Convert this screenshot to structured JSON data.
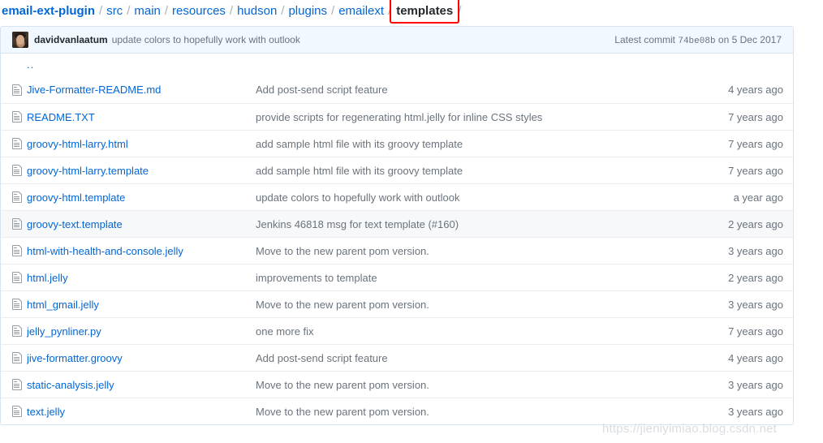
{
  "breadcrumb": {
    "repo": "email-ext-plugin",
    "separator": "/",
    "segments": [
      "src",
      "main",
      "resources",
      "hudson",
      "plugins",
      "emailext"
    ],
    "current": "templates",
    "trailing_separator": "/",
    "highlight_color": "#ff0000"
  },
  "commit_bar": {
    "author": "davidvanlaatum",
    "message": "update colors to hopefully work with outlook",
    "latest_commit_label": "Latest commit",
    "sha": "74be08b",
    "date_prefix": "on",
    "date": "5 Dec 2017",
    "background": "#f1f8ff"
  },
  "parent_row": {
    "label": "..",
    "icon": "up-directory-link"
  },
  "files": [
    {
      "icon": "file-icon",
      "name": "Jive-Formatter-README.md",
      "message": "Add post-send script feature",
      "age": "4 years ago",
      "hovered": false
    },
    {
      "icon": "file-icon",
      "name": "README.TXT",
      "message": "provide scripts for regenerating html.jelly for inline CSS styles",
      "age": "7 years ago",
      "hovered": false
    },
    {
      "icon": "file-icon",
      "name": "groovy-html-larry.html",
      "message": "add sample html file with its groovy template",
      "age": "7 years ago",
      "hovered": false
    },
    {
      "icon": "file-icon",
      "name": "groovy-html-larry.template",
      "message": "add sample html file with its groovy template",
      "age": "7 years ago",
      "hovered": false
    },
    {
      "icon": "file-icon",
      "name": "groovy-html.template",
      "message": "update colors to hopefully work with outlook",
      "age": "a year ago",
      "hovered": false
    },
    {
      "icon": "file-icon",
      "name": "groovy-text.template",
      "message": "Jenkins 46818 msg for text template (#160)",
      "age": "2 years ago",
      "hovered": true
    },
    {
      "icon": "file-icon",
      "name": "html-with-health-and-console.jelly",
      "message": "Move to the new parent pom version.",
      "age": "3 years ago",
      "hovered": false
    },
    {
      "icon": "file-icon",
      "name": "html.jelly",
      "message": "improvements to template",
      "age": "2 years ago",
      "hovered": false
    },
    {
      "icon": "file-icon",
      "name": "html_gmail.jelly",
      "message": "Move to the new parent pom version.",
      "age": "3 years ago",
      "hovered": false
    },
    {
      "icon": "file-icon",
      "name": "jelly_pynliner.py",
      "message": "one more fix",
      "age": "7 years ago",
      "hovered": false
    },
    {
      "icon": "file-icon",
      "name": "jive-formatter.groovy",
      "message": "Add post-send script feature",
      "age": "4 years ago",
      "hovered": false
    },
    {
      "icon": "file-icon",
      "name": "static-analysis.jelly",
      "message": "Move to the new parent pom version.",
      "age": "3 years ago",
      "hovered": false
    },
    {
      "icon": "file-icon",
      "name": "text.jelly",
      "message": "Move to the new parent pom version.",
      "age": "3 years ago",
      "hovered": false
    }
  ],
  "watermark": "https://jieniyimiao.blog.csdn.net",
  "colors": {
    "link": "#0366d6",
    "muted": "#6a737d",
    "border": "#eaecef",
    "hover_row": "#f6f8fa"
  }
}
